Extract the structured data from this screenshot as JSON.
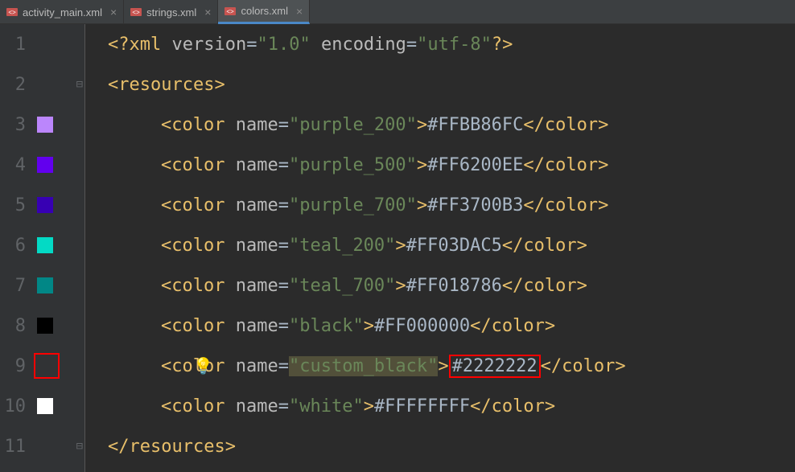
{
  "tabs": [
    {
      "label": "activity_main.xml",
      "active": false
    },
    {
      "label": "strings.xml",
      "active": false
    },
    {
      "label": "colors.xml",
      "active": true
    }
  ],
  "xml_decl": {
    "open": "<?",
    "name": "xml",
    "version_attr": "version",
    "version_val": "\"1.0\"",
    "encoding_attr": "encoding",
    "encoding_val": "\"utf-8\"",
    "close": "?>"
  },
  "root_open": "<resources>",
  "root_close": "</resources>",
  "lines": [
    {
      "num": "1"
    },
    {
      "num": "2"
    },
    {
      "num": "3",
      "swatch": "#BB86FC"
    },
    {
      "num": "4",
      "swatch": "#6200EE"
    },
    {
      "num": "5",
      "swatch": "#3700B3"
    },
    {
      "num": "6",
      "swatch": "#03DAC5"
    },
    {
      "num": "7",
      "swatch": "#018786"
    },
    {
      "num": "8",
      "swatch": "#000000"
    },
    {
      "num": "9",
      "outline": true,
      "bulb": true
    },
    {
      "num": "10",
      "swatch": "#FFFFFF"
    },
    {
      "num": "11"
    }
  ],
  "colors": [
    {
      "name": "\"purple_200\"",
      "value": "#FFBB86FC"
    },
    {
      "name": "\"purple_500\"",
      "value": "#FF6200EE"
    },
    {
      "name": "\"purple_700\"",
      "value": "#FF3700B3"
    },
    {
      "name": "\"teal_200\"",
      "value": "#FF03DAC5"
    },
    {
      "name": "\"teal_700\"",
      "value": "#FF018786"
    },
    {
      "name": "\"black\"",
      "value": "#FF000000"
    },
    {
      "name": "\"custom_black\"",
      "value": "#2222222",
      "highlight": true
    },
    {
      "name": "\"white\"",
      "value": "#FFFFFFFF"
    }
  ],
  "tokens": {
    "color_open": "<color",
    "name_attr": "name",
    "eq": "=",
    "gt": ">",
    "color_close": "</color>",
    "tab_close": "×"
  }
}
